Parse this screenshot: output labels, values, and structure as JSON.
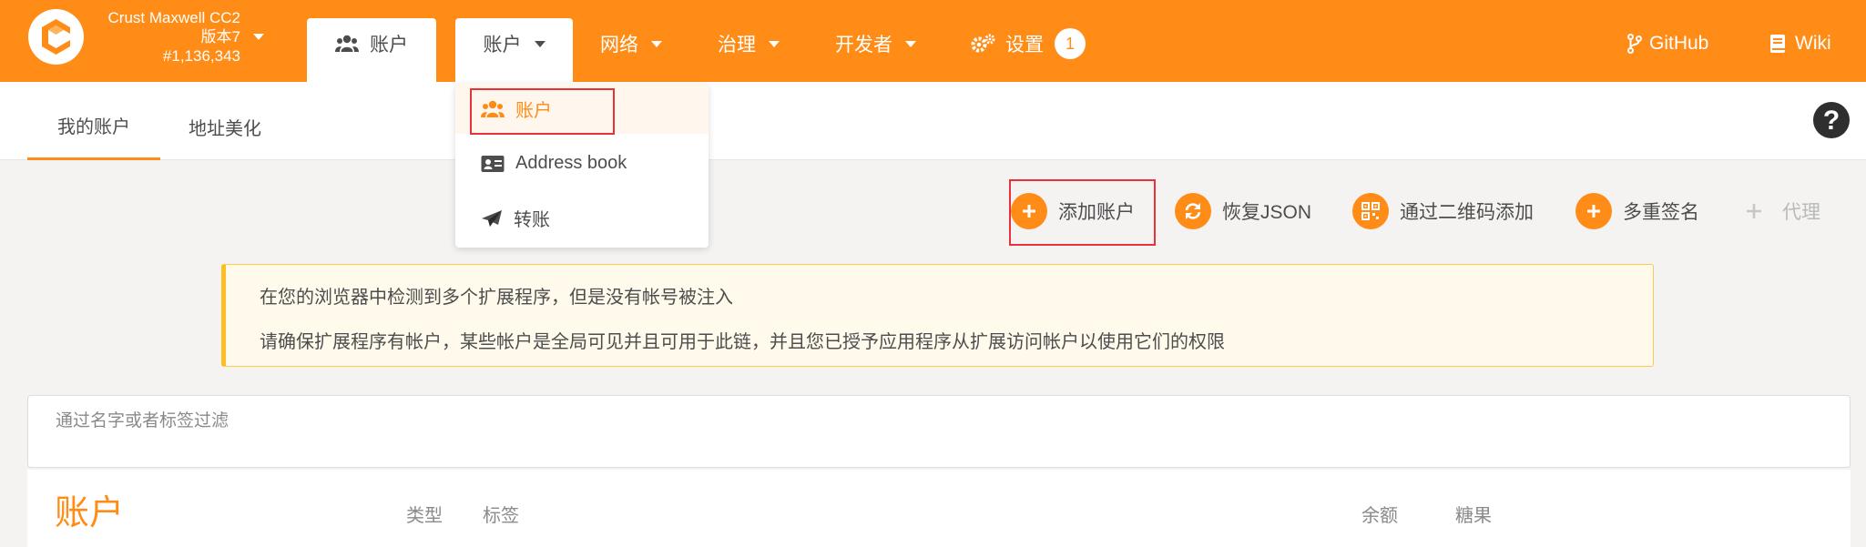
{
  "header": {
    "chain_name": "Crust Maxwell CC2",
    "chain_version": "版本7",
    "block_number": "#1,136,343",
    "nav": {
      "accounts_active": "账户",
      "accounts_menu": "账户",
      "network": "网络",
      "governance": "治理",
      "developer": "开发者",
      "settings": "设置",
      "settings_badge": "1",
      "github": "GitHub",
      "wiki": "Wiki"
    }
  },
  "dropdown": {
    "items": [
      {
        "label": "账户",
        "icon": "users-icon",
        "selected": true
      },
      {
        "label": "Address book",
        "icon": "address-card-icon",
        "selected": false
      },
      {
        "label": "转账",
        "icon": "paper-plane-icon",
        "selected": false
      }
    ]
  },
  "subnav": {
    "tabs": [
      "我的账户",
      "地址美化"
    ]
  },
  "actions": {
    "add_account": "添加账户",
    "restore_json": "恢复JSON",
    "add_via_qr": "通过二维码添加",
    "multisig": "多重签名",
    "proxy": "代理"
  },
  "warning": {
    "line1": "在您的浏览器中检测到多个扩展程序，但是没有帐号被注入",
    "line2": "请确保扩展程序有帐户，某些帐户是全局可见并且可用于此链，并且您已授予应用程序从扩展访问帐户以使用它们的权限"
  },
  "filter": {
    "placeholder": "通过名字或者标签过滤"
  },
  "table": {
    "title": "账户",
    "columns": {
      "type": "类型",
      "tags": "标签",
      "balance": "余额",
      "candy": "糖果"
    }
  },
  "colors": {
    "brand": "#ff8c17",
    "highlight": "#e8313b"
  }
}
